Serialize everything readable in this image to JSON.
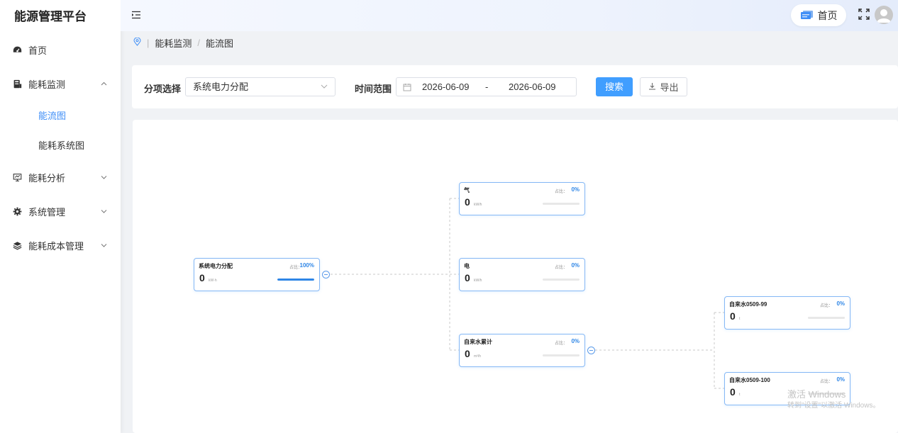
{
  "app": {
    "title": "能源管理平台"
  },
  "sidebar": {
    "items": [
      {
        "label": "首页",
        "icon": "dashboard-icon"
      },
      {
        "label": "能耗监测",
        "icon": "monitor-icon",
        "expanded": true,
        "children": [
          {
            "label": "能流图",
            "active": true
          },
          {
            "label": "能耗系统图"
          }
        ]
      },
      {
        "label": "能耗分析",
        "icon": "analysis-icon"
      },
      {
        "label": "系统管理",
        "icon": "gear-icon"
      },
      {
        "label": "能耗成本管理",
        "icon": "layers-icon"
      }
    ]
  },
  "header": {
    "home_label": "首页"
  },
  "breadcrumb": [
    "能耗监测",
    "能流图"
  ],
  "filters": {
    "category_label": "分项选择",
    "category_value": "系统电力分配",
    "time_label": "时间范围",
    "start_date": "2026-06-09",
    "range_sep": "-",
    "end_date": "2026-06-09",
    "search_label": "搜索",
    "export_label": "导出"
  },
  "flow": {
    "pct_label": "占比：",
    "nodes": [
      {
        "id": "root",
        "title": "系统电力分配",
        "value": "0",
        "unit": "kW·h",
        "pct": "100%",
        "fill": 1.0
      },
      {
        "id": "gas",
        "title": "气",
        "value": "0",
        "unit": "kW/h",
        "pct": "0%",
        "fill": 0.0
      },
      {
        "id": "elec",
        "title": "电",
        "value": "0",
        "unit": "kW/h",
        "pct": "0%",
        "fill": 0.0
      },
      {
        "id": "water_total",
        "title": "自来水累计",
        "value": "0",
        "unit": "m³/h",
        "pct": "0%",
        "fill": 0.0
      },
      {
        "id": "water_99",
        "title": "自来水0509-99",
        "value": "0",
        "unit": "t",
        "pct": "0%",
        "fill": 0.0
      },
      {
        "id": "water_100",
        "title": "自来水0509-100",
        "value": "0",
        "unit": "t",
        "pct": "0%",
        "fill": 0.0
      }
    ]
  },
  "watermark": {
    "line1": "激活 Windows",
    "line2": "转到\"设置\"以激活 Windows。"
  }
}
